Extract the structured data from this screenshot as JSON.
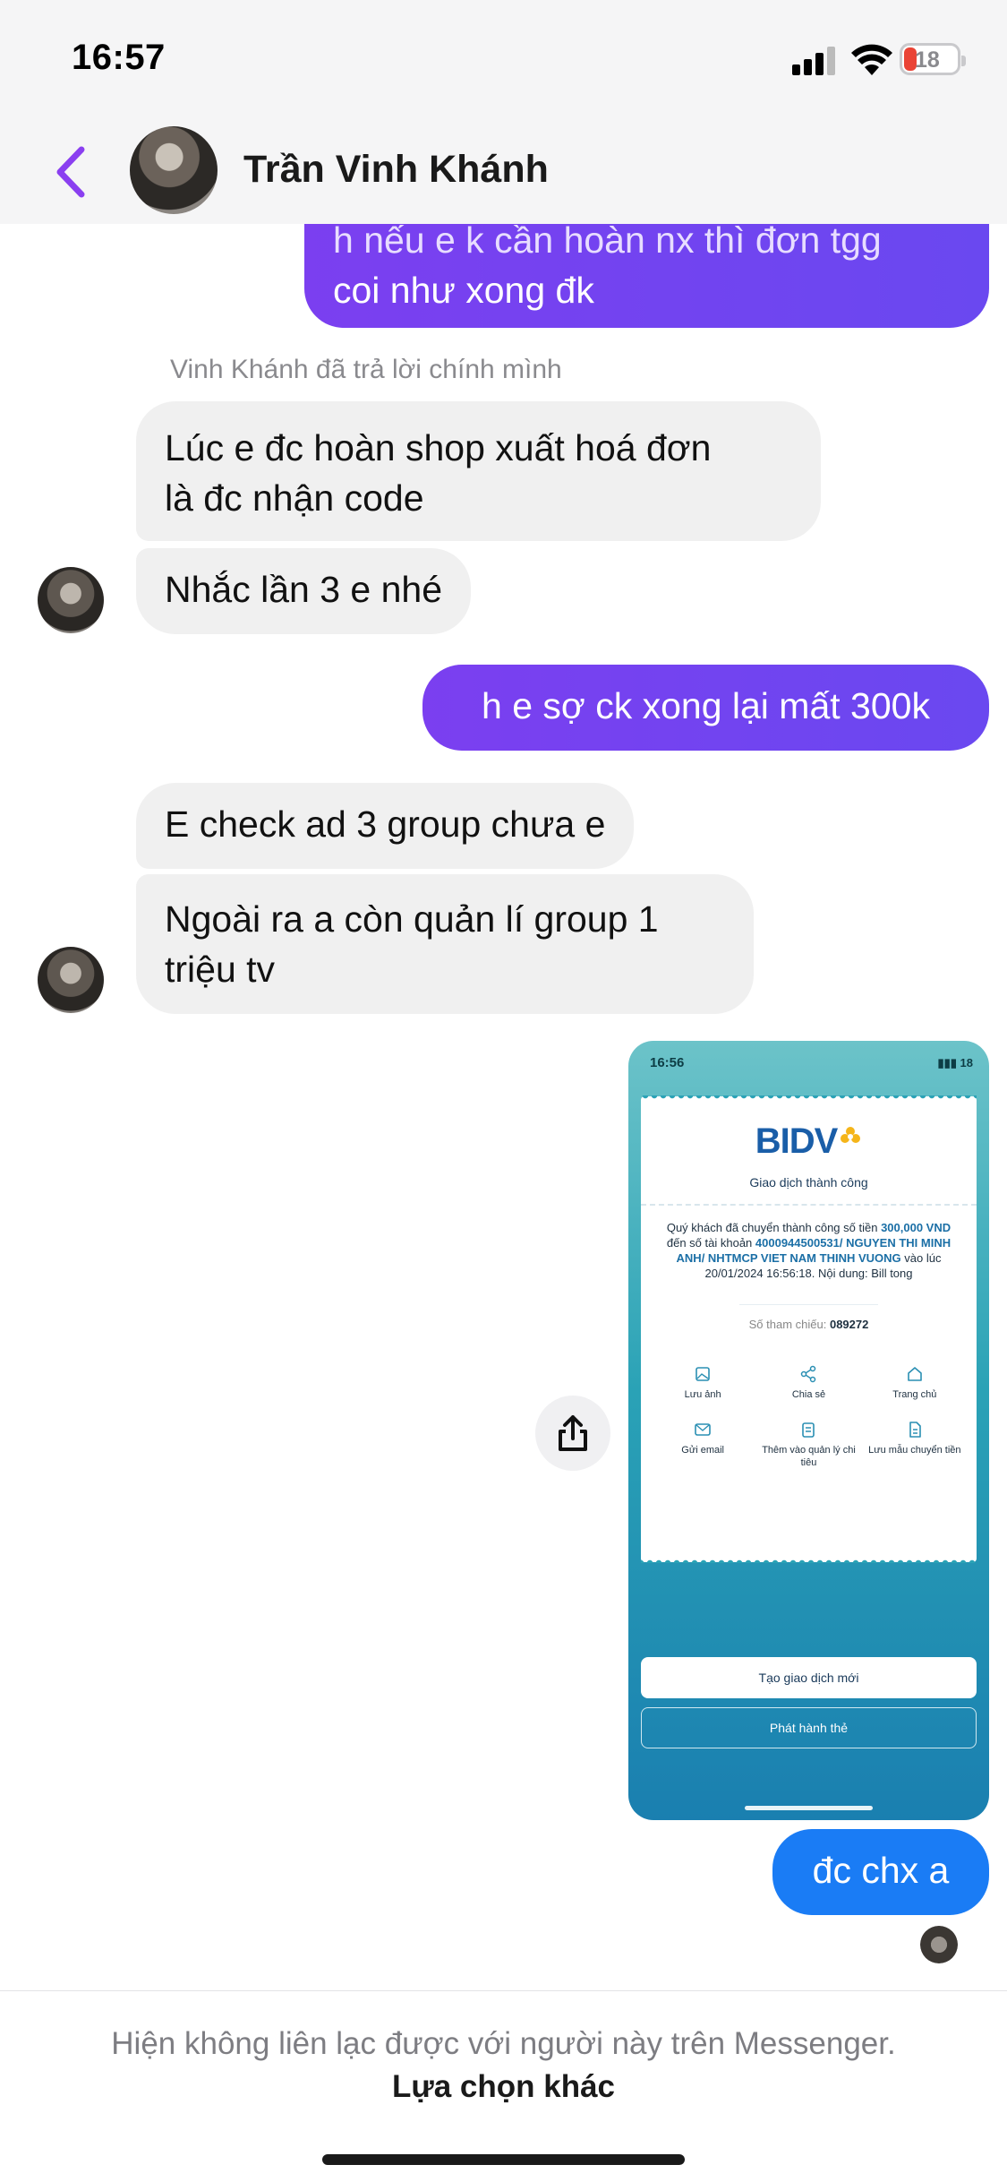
{
  "status_bar": {
    "time": "16:57",
    "battery": "18"
  },
  "header": {
    "contact_name": "Trần Vinh Khánh",
    "back_icon": "chevron-left-icon"
  },
  "messages": [
    {
      "side": "out",
      "text_line1": "h nếu e k cần hoàn nx thì đơn tgg",
      "text_line2": "coi như xong đk"
    },
    {
      "side": "note",
      "text": "Vinh Khánh đã trả lời chính mình"
    },
    {
      "side": "in",
      "text_line1": "Lúc e đc hoàn shop xuất hoá đơn",
      "text_line2": "là đc nhận code"
    },
    {
      "side": "in",
      "text": "Nhắc lần 3 e nhé"
    },
    {
      "side": "out",
      "text": "h e sợ ck xong lại mất 300k"
    },
    {
      "side": "in",
      "text": "E check ad 3 group chưa e"
    },
    {
      "side": "in",
      "text_line1": "Ngoài ra a còn quản lí group 1",
      "text_line2": "triệu tv"
    },
    {
      "side": "out",
      "text": "đc chx a"
    }
  ],
  "screenshot": {
    "time": "16:56",
    "battery": "18",
    "bank_name": "BIDV",
    "title": "Giao dịch thành công",
    "body_prefix": "Quý khách đã chuyển thành công số tiền",
    "amount": "300,000 VND",
    "body_mid": "đến số tài khoản",
    "account": "4000944500531/ NGUYEN THI MINH ANH/ NHTMCP VIET NAM THINH VUONG",
    "body_suffix": "vào lúc 20/01/2024 16:56:18. Nội dung: Bill tong",
    "ref_label": "Số tham chiếu:",
    "ref_value": "089272",
    "actions": [
      {
        "label": "Lưu ảnh",
        "icon": "image-icon"
      },
      {
        "label": "Chia sẻ",
        "icon": "share-icon"
      },
      {
        "label": "Trang chủ",
        "icon": "home-icon"
      },
      {
        "label": "Gửi email",
        "icon": "mail-icon"
      },
      {
        "label": "Thêm vào quản lý chi tiêu",
        "icon": "clipboard-icon"
      },
      {
        "label": "Lưu mẫu chuyển tiền",
        "icon": "document-icon"
      }
    ],
    "button_new": "Tạo giao dịch mới",
    "button_card": "Phát hành thẻ"
  },
  "footer": {
    "note": "Hiện không liên lạc được với người này trên Messenger.",
    "link": "Lựa chọn khác"
  },
  "colors": {
    "accent_purple": "#7b3ff0",
    "accent_blue": "#1a7cf5",
    "bank_teal": "#2aa2b6"
  }
}
